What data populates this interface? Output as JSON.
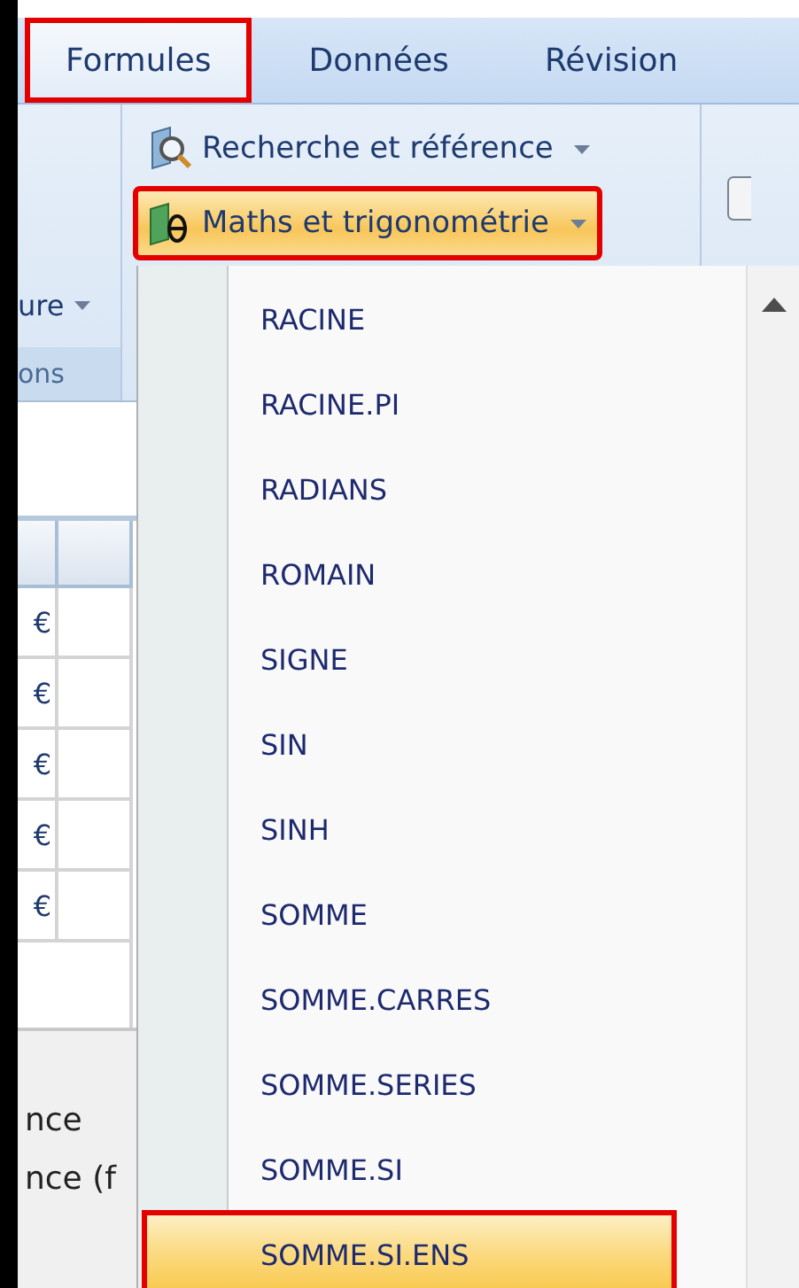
{
  "tabs": [
    {
      "label": "Formules",
      "selected": true,
      "annotated": true
    },
    {
      "label": "Données",
      "selected": false,
      "annotated": false
    },
    {
      "label": "Révision",
      "selected": false,
      "annotated": false
    }
  ],
  "ribbon": {
    "left_group": {
      "button": "ure",
      "group_label": "ons"
    },
    "buttons": [
      {
        "kind": "lookup",
        "label": "Recherche et référence",
        "open": false,
        "annotated": false
      },
      {
        "kind": "math",
        "label": "Maths et trigonométrie",
        "open": true,
        "annotated": true
      }
    ]
  },
  "sheet": {
    "rows": [
      {
        "column_1": "€"
      },
      {
        "column_1": "€"
      },
      {
        "column_1": "€"
      },
      {
        "column_1": "€"
      },
      {
        "column_1": "€"
      }
    ],
    "panel_lines": [
      "nce",
      "nce (f"
    ]
  },
  "menu": {
    "items": [
      {
        "label": "RACINE",
        "selected": false,
        "annotated": false
      },
      {
        "label": "RACINE.PI",
        "selected": false,
        "annotated": false
      },
      {
        "label": "RADIANS",
        "selected": false,
        "annotated": false
      },
      {
        "label": "ROMAIN",
        "selected": false,
        "annotated": false
      },
      {
        "label": "SIGNE",
        "selected": false,
        "annotated": false
      },
      {
        "label": "SIN",
        "selected": false,
        "annotated": false
      },
      {
        "label": "SINH",
        "selected": false,
        "annotated": false
      },
      {
        "label": "SOMME",
        "selected": false,
        "annotated": false
      },
      {
        "label": "SOMME.CARRES",
        "selected": false,
        "annotated": false
      },
      {
        "label": "SOMME.SERIES",
        "selected": false,
        "annotated": false
      },
      {
        "label": "SOMME.SI",
        "selected": false,
        "annotated": false
      },
      {
        "label": "SOMME.SI.ENS",
        "selected": true,
        "annotated": true
      }
    ]
  }
}
